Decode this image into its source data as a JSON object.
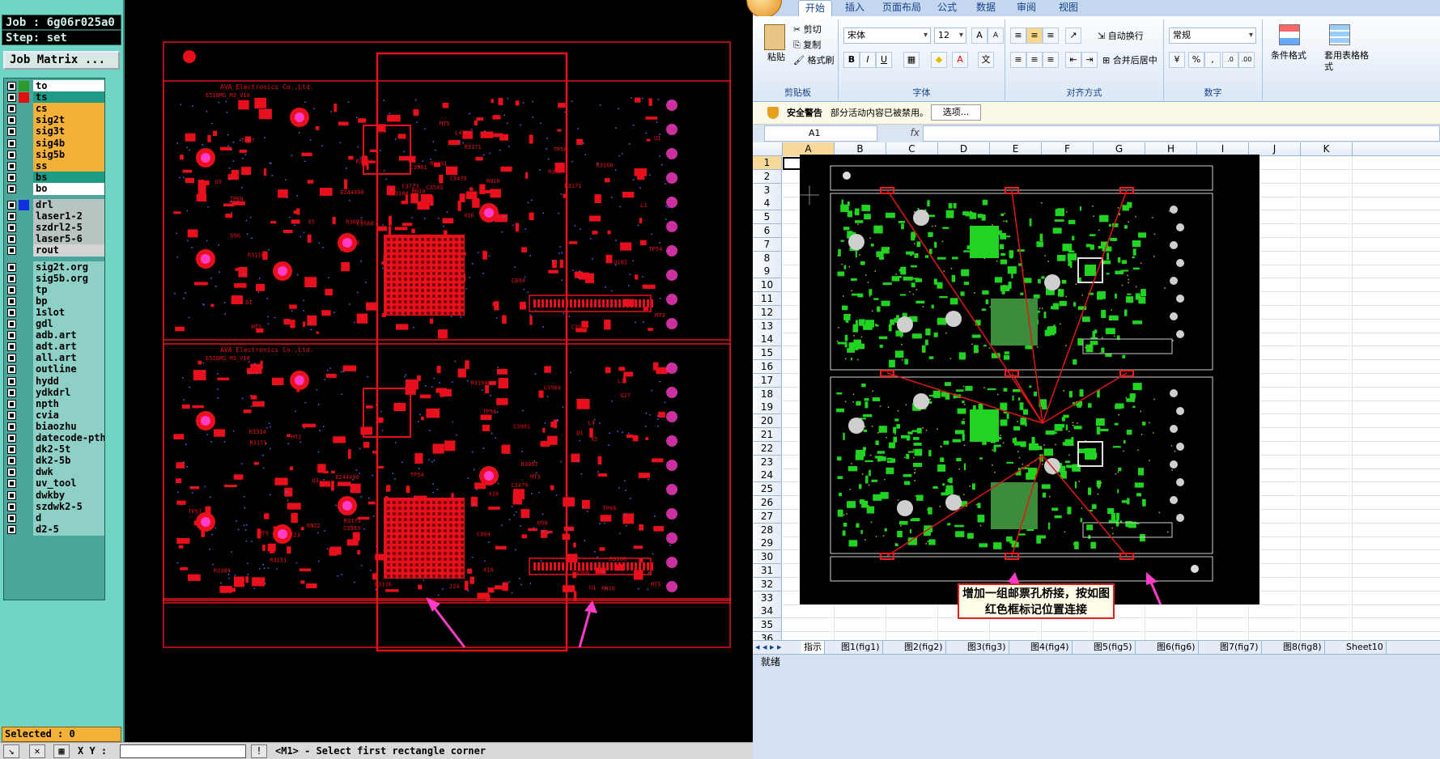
{
  "cam": {
    "job": "Job : 6g06r025a0",
    "step": "Step: set",
    "job_matrix": "Job Matrix ...",
    "layers": [
      {
        "name": "to",
        "color": "#ffffff",
        "swatch": "#2a9a2a"
      },
      {
        "name": "ts",
        "color": "#1f9a85",
        "swatch": "#e01010"
      },
      {
        "name": "cs",
        "color": "#f3b13a",
        "swatch": null
      },
      {
        "name": "sig2t",
        "color": "#f3b13a",
        "swatch": null
      },
      {
        "name": "sig3t",
        "color": "#f3b13a",
        "swatch": null
      },
      {
        "name": "sig4b",
        "color": "#f3b13a",
        "swatch": null
      },
      {
        "name": "sig5b",
        "color": "#f3b13a",
        "swatch": null
      },
      {
        "name": "ss",
        "color": "#f3b13a",
        "swatch": null
      },
      {
        "name": "bs",
        "color": "#1f9a85",
        "swatch": null
      },
      {
        "name": "bo",
        "color": "#ffffff",
        "swatch": null
      },
      {
        "name": "drl",
        "color": "#b8c4c2",
        "swatch": "#1030e0"
      },
      {
        "name": "laser1-2",
        "color": "#b8c4c2",
        "swatch": null
      },
      {
        "name": "szdrl2-5",
        "color": "#b8c4c2",
        "swatch": null
      },
      {
        "name": "laser5-6",
        "color": "#b8c4c2",
        "swatch": null
      },
      {
        "name": "rout",
        "color": "#d4d4d4",
        "swatch": null
      },
      {
        "name": "sig2t.org",
        "color": "#8fd0c6",
        "swatch": null
      },
      {
        "name": "sig5b.org",
        "color": "#8fd0c6",
        "swatch": null
      },
      {
        "name": "tp",
        "color": "#8fd0c6",
        "swatch": null
      },
      {
        "name": "bp",
        "color": "#8fd0c6",
        "swatch": null
      },
      {
        "name": "1slot",
        "color": "#8fd0c6",
        "swatch": null
      },
      {
        "name": "gdl",
        "color": "#8fd0c6",
        "swatch": null
      },
      {
        "name": "adb.art",
        "color": "#8fd0c6",
        "swatch": null
      },
      {
        "name": "adt.art",
        "color": "#8fd0c6",
        "swatch": null
      },
      {
        "name": "all.art",
        "color": "#8fd0c6",
        "swatch": null
      },
      {
        "name": "outline",
        "color": "#8fd0c6",
        "swatch": null
      },
      {
        "name": "hydd",
        "color": "#8fd0c6",
        "swatch": null
      },
      {
        "name": "ydkdrl",
        "color": "#8fd0c6",
        "swatch": null
      },
      {
        "name": "npth",
        "color": "#8fd0c6",
        "swatch": null
      },
      {
        "name": "cvia",
        "color": "#8fd0c6",
        "swatch": null
      },
      {
        "name": "biaozhu",
        "color": "#8fd0c6",
        "swatch": null
      },
      {
        "name": "datecode-pth",
        "color": "#8fd0c6",
        "swatch": null
      },
      {
        "name": "dk2-5t",
        "color": "#8fd0c6",
        "swatch": null
      },
      {
        "name": "dk2-5b",
        "color": "#8fd0c6",
        "swatch": null
      },
      {
        "name": "dwk",
        "color": "#8fd0c6",
        "swatch": null
      },
      {
        "name": "uv_tool",
        "color": "#8fd0c6",
        "swatch": null
      },
      {
        "name": "dwkby",
        "color": "#8fd0c6",
        "swatch": null
      },
      {
        "name": "szdwk2-5",
        "color": "#8fd0c6",
        "swatch": null
      },
      {
        "name": "d",
        "color": "#8fd0c6",
        "swatch": null
      },
      {
        "name": "d2-5",
        "color": "#8fd0c6",
        "swatch": null
      }
    ],
    "selected": "Selected : 0",
    "xy_label": "X Y :",
    "command_msg": "<M1> - Select first rectangle corner",
    "board_title": "AVA Electronics Co.,Ltd.",
    "board_part": "E518MS_M3_V10",
    "refs": [
      "R3168",
      "C3560",
      "R3171",
      "MT5",
      "RN10",
      "X18",
      "U3",
      "R3116",
      "R3097",
      "RN22",
      "TP57",
      "TP66",
      "U102",
      "TP56",
      "TP54",
      "C3723",
      "J24",
      "X5",
      "L4",
      "R3334",
      "E244490",
      "C3479",
      "MT3",
      "MT2",
      "R3384",
      "X16",
      "U27",
      "C3583",
      "R3151",
      "C3981",
      "D1",
      "U96",
      "L1",
      "U1",
      "C804"
    ]
  },
  "excel": {
    "tabs": [
      "开始",
      "插入",
      "页面布局",
      "公式",
      "数据",
      "审阅",
      "视图"
    ],
    "clipboard": {
      "paste": "粘贴",
      "cut": "剪切",
      "copy": "复制",
      "format": "格式刷",
      "label": "剪贴板"
    },
    "font": {
      "name": "宋体",
      "size": "12",
      "label": "字体"
    },
    "align": {
      "wrap": "自动换行",
      "merge": "合并后居中",
      "label": "对齐方式"
    },
    "number": {
      "format": "常规",
      "label": "数字"
    },
    "styles": {
      "cond": "条件格式",
      "table": "套用表格格式"
    },
    "security": {
      "title": "安全警告",
      "msg": "部分活动内容已被禁用。",
      "button": "选项..."
    },
    "namebox": "A1",
    "fx": "fx",
    "columns": [
      "A",
      "B",
      "C",
      "D",
      "E",
      "F",
      "G",
      "H",
      "I",
      "J",
      "K"
    ],
    "rows": [
      "1",
      "2",
      "3",
      "4",
      "5",
      "6",
      "7",
      "8",
      "9",
      "10",
      "11",
      "12",
      "13",
      "14",
      "15",
      "16",
      "17",
      "18",
      "19",
      "20",
      "21",
      "22",
      "23",
      "24",
      "25",
      "26",
      "27",
      "28",
      "29",
      "30",
      "31",
      "32",
      "33",
      "34",
      "35",
      "36"
    ],
    "callout": "增加一组邮票孔桥接，按如图红色框标记位置连接",
    "sheets": [
      "指示",
      "图1(fig1)",
      "图2(fig2)",
      "图3(fig3)",
      "图4(fig4)",
      "图5(fig5)",
      "图6(fig6)",
      "图7(fig7)",
      "图8(fig8)",
      "Sheet10"
    ],
    "status": "就绪"
  }
}
